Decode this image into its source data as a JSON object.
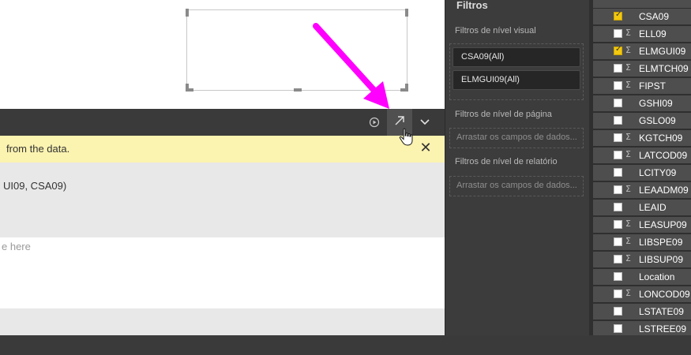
{
  "editor": {
    "warning": "from the data.",
    "code_fragment": "UI09, CSA09)",
    "placeholder": "e here",
    "run_icon": "play-circle-icon",
    "expand_icon": "arrow-up-right-icon",
    "collapse_icon": "chevron-down-icon",
    "close_glyph": "✕"
  },
  "filters": {
    "title": "Filtros",
    "visual_level_label": "Filtros de nível visual",
    "visual_filters": [
      {
        "label": "CSA09(All)"
      },
      {
        "label": "ELMGUI09(All)"
      }
    ],
    "page_level_label": "Filtros de nível de página",
    "page_drop_text": "Arrastar os campos de dados...",
    "report_level_label": "Filtros de nível de relatório",
    "report_drop_text": "Arrastar os campos de dados..."
  },
  "fields": [
    {
      "name": "CSA09",
      "checked": true,
      "sigma": false
    },
    {
      "name": "ELL09",
      "checked": false,
      "sigma": true
    },
    {
      "name": "ELMGUI09",
      "checked": true,
      "sigma": true
    },
    {
      "name": "ELMTCH09",
      "checked": false,
      "sigma": true
    },
    {
      "name": "FIPST",
      "checked": false,
      "sigma": true
    },
    {
      "name": "GSHI09",
      "checked": false,
      "sigma": false
    },
    {
      "name": "GSLO09",
      "checked": false,
      "sigma": false
    },
    {
      "name": "KGTCH09",
      "checked": false,
      "sigma": true
    },
    {
      "name": "LATCOD09",
      "checked": false,
      "sigma": true
    },
    {
      "name": "LCITY09",
      "checked": false,
      "sigma": false
    },
    {
      "name": "LEAADM09",
      "checked": false,
      "sigma": true
    },
    {
      "name": "LEAID",
      "checked": false,
      "sigma": false
    },
    {
      "name": "LEASUP09",
      "checked": false,
      "sigma": true
    },
    {
      "name": "LIBSPE09",
      "checked": false,
      "sigma": true
    },
    {
      "name": "LIBSUP09",
      "checked": false,
      "sigma": true
    },
    {
      "name": "Location",
      "checked": false,
      "sigma": false
    },
    {
      "name": "LONCOD09",
      "checked": false,
      "sigma": true
    },
    {
      "name": "LSTATE09",
      "checked": false,
      "sigma": false
    },
    {
      "name": "LSTREE09",
      "checked": false,
      "sigma": false
    }
  ],
  "colors": {
    "annotation": "#ff00ff",
    "checkbox_checked": "#f2c811",
    "warning_bg": "#fbf3b0"
  }
}
